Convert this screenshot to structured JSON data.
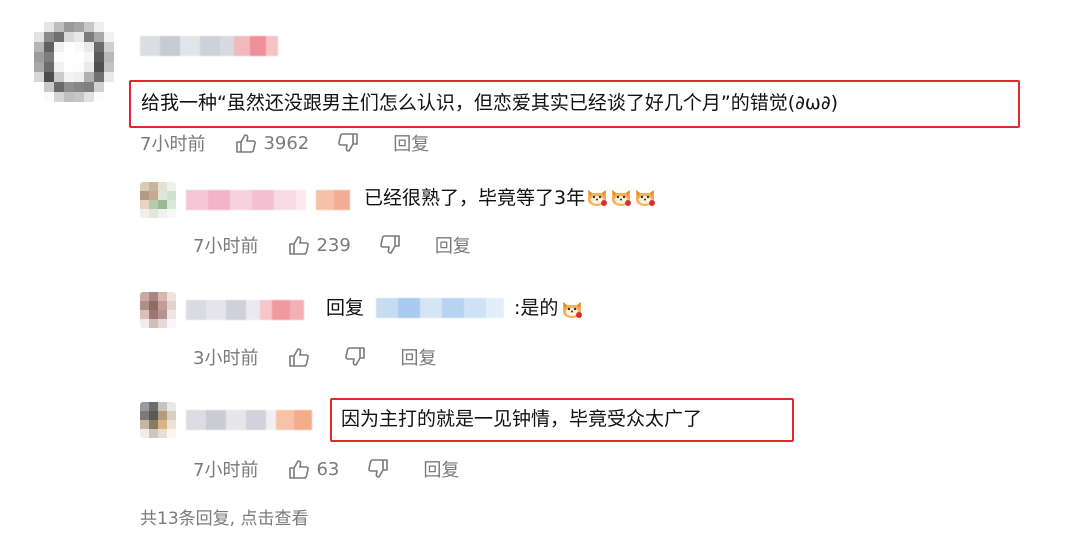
{
  "main_comment": {
    "text": "给我一种“虽然还没跟男主们怎么认识，但恋爱其实已经谈了好几个月”的错觉(∂ω∂)",
    "time": "7小时前",
    "likes": "3962",
    "reply_label": "回复"
  },
  "replies": [
    {
      "text": "已经很熟了，毕竟等了3年",
      "emoji": [
        "dog-face-emoji",
        "dog-face-emoji",
        "dog-face-emoji"
      ],
      "time": "7小时前",
      "likes": "239",
      "reply_label": "回复"
    },
    {
      "reply_prefix": "回复",
      "text": ":是的",
      "emoji": [
        "dog-face-emoji"
      ],
      "time": "3小时前",
      "likes": "",
      "reply_label": "回复"
    },
    {
      "text": "因为主打的就是一见钟情，毕竟受众太广了",
      "time": "7小时前",
      "likes": "63",
      "reply_label": "回复"
    }
  ],
  "footer": {
    "view_all": "共13条回复, 点击查看"
  },
  "colors": {
    "highlight_box": "#e0272e",
    "meta_text": "#7a7a7a",
    "body_text": "#111111"
  }
}
